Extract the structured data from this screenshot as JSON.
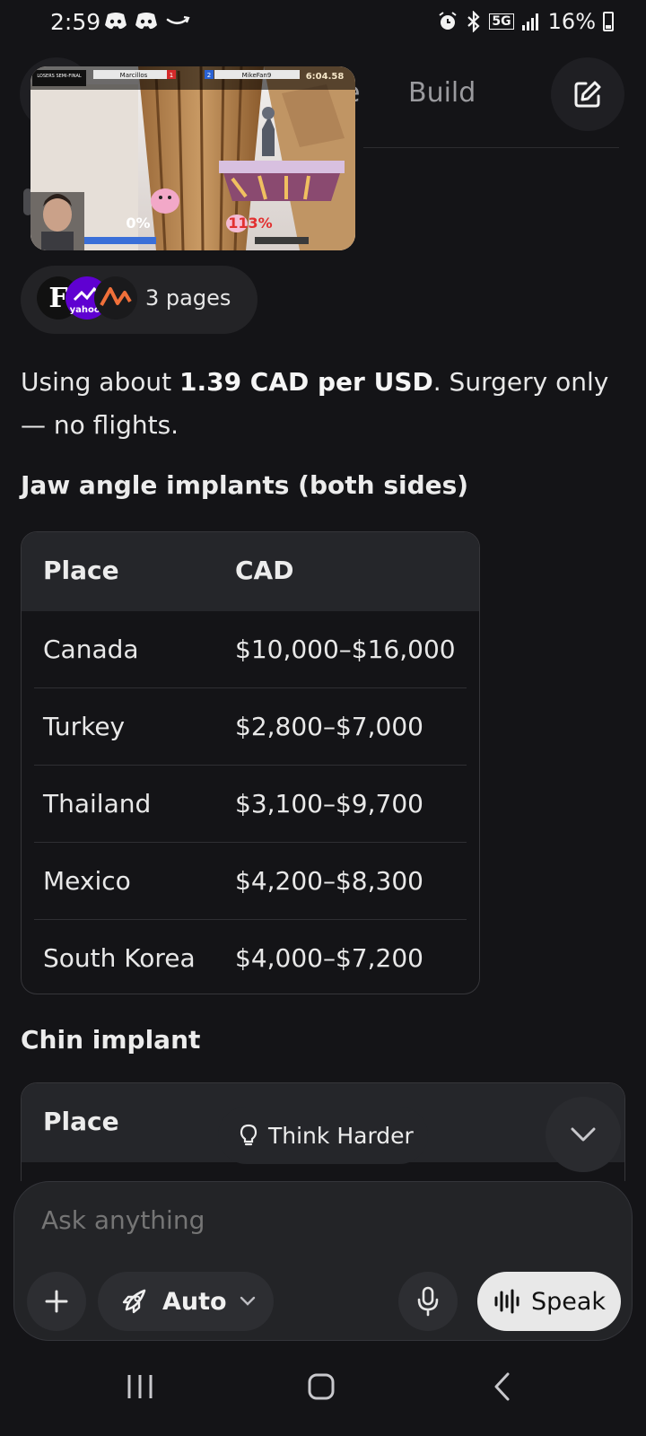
{
  "status_bar": {
    "time": "2:59",
    "network": "5G",
    "battery": "16%"
  },
  "top_nav": {
    "tab_partial": "e",
    "tab_build": "Build"
  },
  "video_overlay": {
    "description": "picture-in-picture gameplay video",
    "hud": {
      "left_player": "Marcillos",
      "left_score": "1",
      "right_player": "MikeFan9",
      "right_score": "2",
      "timer": "6:04.58",
      "left_percent": "0%",
      "right_percent": "113%",
      "bracket": "LOSERS SEMI-FINAL"
    }
  },
  "sources_chip": {
    "label": "3 pages",
    "icons": [
      "forbes-icon",
      "yahoo-icon",
      "source-icon"
    ],
    "icon_texts": [
      "F",
      "yahoo!"
    ]
  },
  "paragraph": {
    "before": "Using about ",
    "bold": "1.39 CAD per USD",
    "after": ". Surgery only — no flights."
  },
  "section1": {
    "heading": "Jaw angle implants (both sides)",
    "columns": [
      "Place",
      "CAD"
    ],
    "rows": [
      {
        "place": "Canada",
        "cad": "$10,000–$16,000"
      },
      {
        "place": "Turkey",
        "cad": "$2,800–$7,000"
      },
      {
        "place": "Thailand",
        "cad": "$3,100–$9,700"
      },
      {
        "place": "Mexico",
        "cad": "$4,200–$8,300"
      },
      {
        "place": "South Korea",
        "cad": "$4,000–$7,200"
      }
    ]
  },
  "section2": {
    "heading": "Chin implant",
    "column_place": "Place"
  },
  "think_harder": "Think Harder",
  "composer": {
    "placeholder": "Ask anything",
    "mode": "Auto",
    "speak": "Speak"
  },
  "colors": {
    "background": "#141417",
    "surface": "#232427",
    "table_head": "#25262a",
    "speak_button": "#e8e8e8"
  }
}
